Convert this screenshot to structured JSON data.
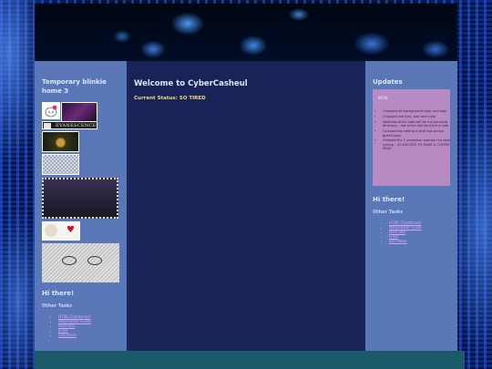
{
  "page": {
    "welcome_title": "Welcome to CyberCasheul",
    "status": "Current Status: SO TIRED"
  },
  "left_sidebar": {
    "title": "Temporary blinkie home 3",
    "badge_text": "EVANESCENCE",
    "hi_title": "Hi there!",
    "other_tasks": "Other Tasks",
    "links": [
      "HTML Cheatsheet",
      "Webmaster Guide",
      "Host Site",
      "Links",
      "Site News"
    ]
  },
  "right_sidebar": {
    "updates_title": "Updates",
    "box_title": "NEW",
    "updates": [
      "Changed all background color and logo",
      "Changed the font, size and color",
      "Deleting which side will be my personal directory - not which will be the fun side",
      "Considering adding a chat box and/or guest book",
      "Ordered the 2 snapshop stamps I've been eyeing - SO EXCITED TO MAKE A COFFEE PAGE"
    ],
    "hi_title": "Hi there!",
    "other_tasks": "Other Tasks",
    "links": [
      "HTML Cheatsheet",
      "Webmaster Guide",
      "Host Site",
      "Links",
      "Site News"
    ]
  },
  "colors": {
    "side_panel": "#5a78b8",
    "center_panel": "#1a2358",
    "updates_box": "#b88ac4",
    "status_text": "#f2d77a",
    "link": "#d9a3ff"
  }
}
